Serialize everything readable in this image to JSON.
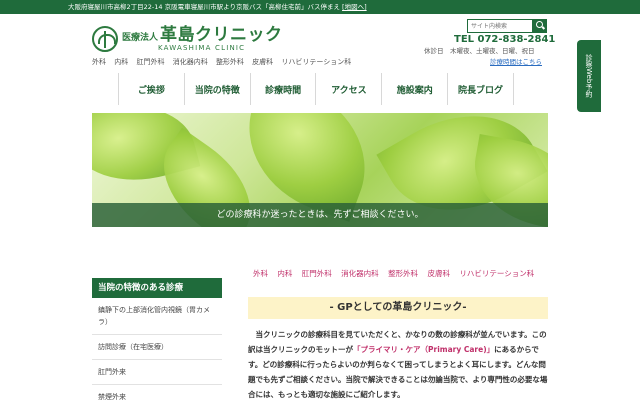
{
  "topbar": {
    "address": "大阪府寝屋川市高柳2丁目22-14 京阪電車寝屋川市駅より京阪バス「高柳住宅前」バス停まえ",
    "map_link": "[地図へ]"
  },
  "logo": {
    "corp": "医療法人",
    "name": "革島クリニック",
    "en": "KAWASHIMA CLINIC"
  },
  "depts_top": [
    "外科",
    "内科",
    "肛門外科",
    "消化器内科",
    "整形外科",
    "皮膚科",
    "リハビリテーション科"
  ],
  "search": {
    "placeholder": "サイト内検索"
  },
  "contact": {
    "tel": "TEL 072-838-2841",
    "holiday": "休診日　木曜夜、土曜夜、日曜、祝日",
    "hours_link": "診療時間はこちら"
  },
  "side_tab": {
    "label": "診察Web予約"
  },
  "nav": {
    "items": [
      "ご挨拶",
      "当院の特徴",
      "診療時間",
      "アクセス",
      "施設案内",
      "院長ブログ"
    ]
  },
  "hero": {
    "caption": "どの診療科か迷ったときは、先ずご相談ください。"
  },
  "sidebar": {
    "heading": "当院の特徴のある診療",
    "items": [
      "鎮静下の上部消化管内視鏡（胃カメラ）",
      "訪問診療（在宅医療）",
      "肛門外来",
      "禁煙外来"
    ]
  },
  "dept_links": [
    "外科",
    "内科",
    "肛門外科",
    "消化器内科",
    "整形外科",
    "皮膚科",
    "リハビリテーション科"
  ],
  "gp": {
    "title": "- GPとしての革島クリニック-"
  },
  "body": {
    "p1": "　当クリニックの診療科目を見ていただくと、かなりの数の診療科が並んでいます。この訳は当クリニックのモットーが",
    "highlight": "「プライマリ・ケア（Primary Care)」",
    "p2": "にあるからです。どの診療科に行ったらよいのか判らなくて困ってしまうとよく耳にします。どんな問題でも先ずご相談ください。当院で解決できることは勿論当院で、より専門性の必要な場合には、もっとも適切な施設にご紹介します。"
  },
  "colors": {
    "brand_green": "#1f6b3b",
    "accent_pink": "#c0306a",
    "banner_yellow": "#fdf3c8"
  }
}
